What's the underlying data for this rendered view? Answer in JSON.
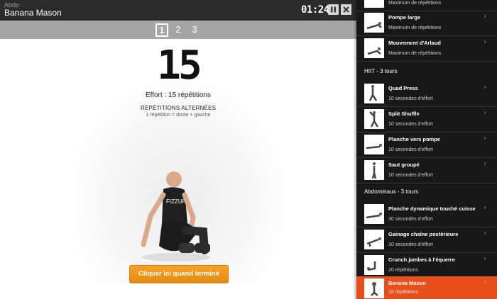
{
  "header": {
    "category": "Abdo",
    "title": "Banana Mason",
    "timer": "01:24",
    "pause_icon": "pause-icon",
    "close_icon": "close-icon"
  },
  "rounds": [
    "1",
    "2",
    "3"
  ],
  "exercise": {
    "reps": "15",
    "effort": "Effort : 15 répétitions",
    "note_title": "RÉPÉTITIONS ALTERNÉES",
    "note_desc": "1 répétition = droite + gauche",
    "done_button": "Cliquer ici quand terminé"
  },
  "sidebar": {
    "top_partial": {
      "sub": "Maximum de répétitions"
    },
    "items_a": [
      {
        "name": "Pompe large",
        "sub": "Maximum de répétitions"
      },
      {
        "name": "Mouvement d'Arlaud",
        "sub": "Maximum de répétitions"
      }
    ],
    "section_hiit": "HIIT - 3 tours",
    "items_b": [
      {
        "name": "Quad Press",
        "sub": "10 secondes d'effort"
      },
      {
        "name": "Split Shuffle",
        "sub": "10 secondes d'effort"
      },
      {
        "name": "Planche vers pompe",
        "sub": "10 secondes d'effort"
      },
      {
        "name": "Saut groupé",
        "sub": "10 secondes d'effort"
      }
    ],
    "section_abdo": "Abdominaux - 3 tours",
    "items_c": [
      {
        "name": "Planche dynamique touché cuisse",
        "sub": "30 secondes d'effort"
      },
      {
        "name": "Gainage chaîne postérieure",
        "sub": "10 secondes d'effort"
      },
      {
        "name": "Crunch jambes à l'équerre",
        "sub": "20 répétitions"
      },
      {
        "name": "Banana Mason",
        "sub": "15 répétitions"
      }
    ],
    "arrow": "›",
    "accent_color": "#e8501b"
  }
}
